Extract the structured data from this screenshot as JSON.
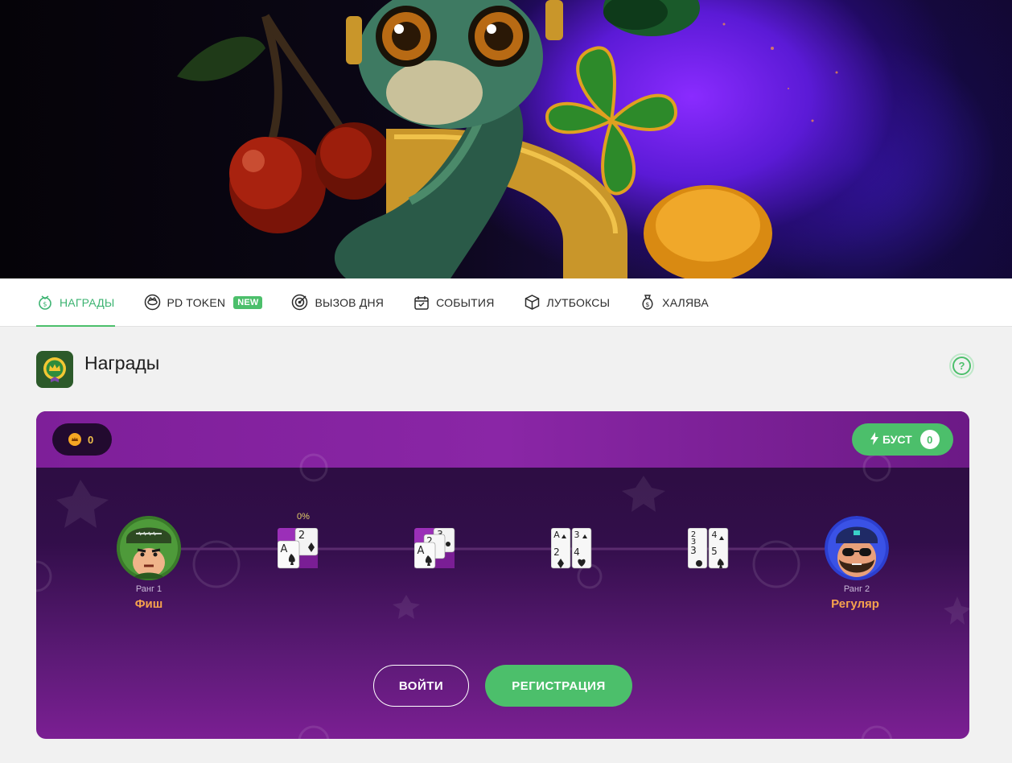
{
  "tabs": [
    {
      "label": "НАГРАДЫ",
      "icon": "medal-icon",
      "active": true
    },
    {
      "label": "PD TOKEN",
      "icon": "token-icon",
      "badge": "NEW"
    },
    {
      "label": "ВЫЗОВ ДНЯ",
      "icon": "target-icon"
    },
    {
      "label": "СОБЫТИЯ",
      "icon": "calendar-icon"
    },
    {
      "label": "ЛУТБОКСЫ",
      "icon": "box-icon"
    },
    {
      "label": "ХАЛЯВА",
      "icon": "money-bag-icon"
    }
  ],
  "section": {
    "title": "Награды",
    "help_label": "?"
  },
  "rewards": {
    "coins": "0",
    "boost_label": "БУСТ",
    "boost_count": "0",
    "progress_percent": "0%",
    "ranks": [
      {
        "label": "Ранг 1",
        "name": "Фиш"
      },
      {
        "label": "Ранг 2",
        "name": "Регуляр"
      }
    ],
    "steps": [
      {
        "cards": [
          "A",
          "2"
        ]
      },
      {
        "cards": [
          "A",
          "2",
          "3"
        ]
      },
      {
        "cards": [
          "A",
          "2",
          "3",
          "4"
        ]
      },
      {
        "cards": [
          "2",
          "3",
          "3",
          "4",
          "5"
        ]
      }
    ],
    "login_label": "ВОЙТИ",
    "register_label": "РЕГИСТРАЦИЯ"
  },
  "colors": {
    "accent": "#4cbf6b",
    "purple": "#7e1f99",
    "rank_name": "#f6a24d"
  }
}
